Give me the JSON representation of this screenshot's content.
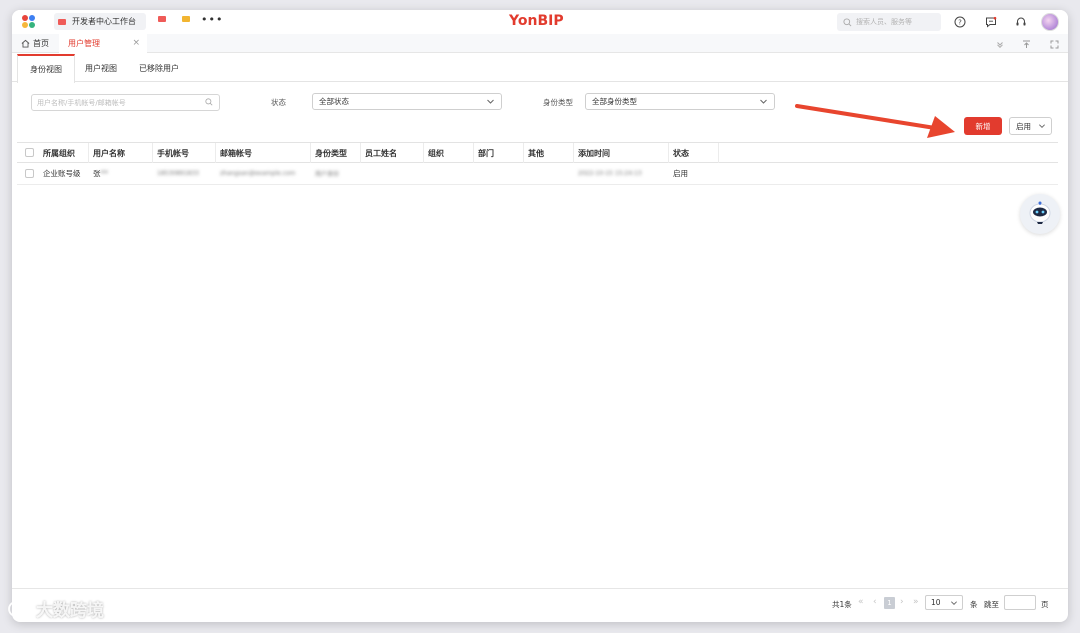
{
  "topbar": {
    "tabs": [
      {
        "label": "开发者中心工作台",
        "icon": "app-icon-red"
      }
    ],
    "extra_icons": [
      "red-app-icon",
      "yellow-app-icon"
    ],
    "more": "•••",
    "brand": "YonBIP",
    "search_placeholder": "搜索人员、服务等",
    "right_icons": [
      "help-icon",
      "message-icon",
      "headset-icon",
      "avatar"
    ]
  },
  "pagetabs": {
    "home": "首页",
    "active": "用户管理",
    "close": "×"
  },
  "viewtabs": [
    "身份视图",
    "用户视图",
    "已移除用户"
  ],
  "filters": {
    "search_placeholder": "用户名称/手机帐号/邮箱帐号",
    "status_label": "状态",
    "status_value": "全部状态",
    "type_label": "身份类型",
    "type_value": "全部身份类型"
  },
  "actions": {
    "new": "新增",
    "enable": "启用"
  },
  "table": {
    "columns": [
      "所属组织",
      "用户名称",
      "手机帐号",
      "邮箱帐号",
      "身份类型",
      "员工姓名",
      "组织",
      "部门",
      "其他",
      "添加时间",
      "状态"
    ],
    "rows": [
      {
        "org": "企业账号级",
        "name": "张",
        "name_blur": "**",
        "phone": "18530891833",
        "email": "zhangsan@example.com",
        "type": "用户身份",
        "employee": "",
        "org2": "",
        "dept": "",
        "other": "",
        "added": "2022-10-15 15:24:13",
        "status": "启用"
      }
    ]
  },
  "pager": {
    "total": "共1条",
    "first": "«",
    "prev": "‹",
    "page": "1",
    "next": "›",
    "last": "»",
    "size": "10",
    "unit": "条",
    "jump": "跳至",
    "page_unit": "页"
  },
  "watermark": "大数跨境",
  "colors": {
    "accent": "#e23b2e"
  }
}
